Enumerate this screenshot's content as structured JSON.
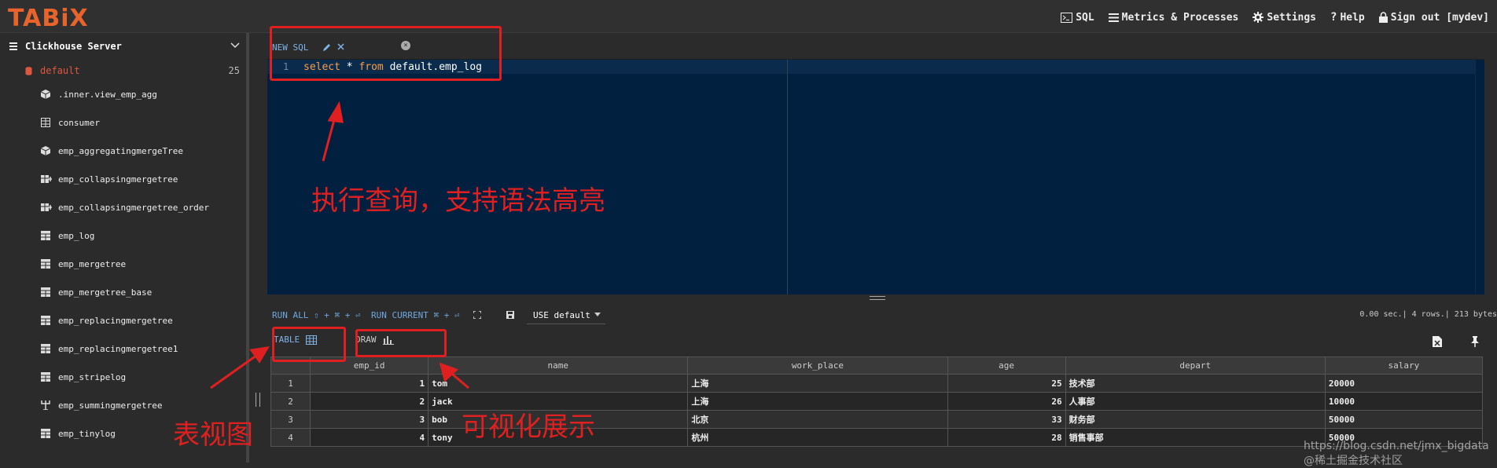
{
  "app": {
    "logo": "TABiX"
  },
  "topnav": [
    {
      "label": "SQL",
      "icon": "terminal-icon"
    },
    {
      "label": "Metrics & Processes",
      "icon": "list-icon"
    },
    {
      "label": "Settings",
      "icon": "gear-icon"
    },
    {
      "label": "Help",
      "icon": "question-icon"
    },
    {
      "label": "Sign out [mydev]",
      "icon": "lock-icon"
    }
  ],
  "sidebar": {
    "server": "Clickhouse Server",
    "database": {
      "name": "default",
      "count": "25"
    },
    "tables": [
      {
        "name": ".inner.view_emp_agg",
        "icon": "cube-icon"
      },
      {
        "name": "consumer",
        "icon": "grid-outline-icon"
      },
      {
        "name": "emp_aggregatingmergeTree",
        "icon": "cube-icon"
      },
      {
        "name": "emp_collapsingmergetree",
        "icon": "table-plus-icon"
      },
      {
        "name": "emp_collapsingmergetree_order",
        "icon": "table-plus-icon"
      },
      {
        "name": "emp_log",
        "icon": "table-icon"
      },
      {
        "name": "emp_mergetree",
        "icon": "table-icon"
      },
      {
        "name": "emp_mergetree_base",
        "icon": "table-icon"
      },
      {
        "name": "emp_replacingmergetree",
        "icon": "table-icon"
      },
      {
        "name": "emp_replacingmergetree1",
        "icon": "table-icon"
      },
      {
        "name": "emp_stripelog",
        "icon": "table-icon"
      },
      {
        "name": "emp_summingmergetree",
        "icon": "trident-icon"
      },
      {
        "name": "emp_tinylog",
        "icon": "table-icon"
      }
    ]
  },
  "editor": {
    "tab_label": "NEW SQL",
    "line_number": "1",
    "code_kw1": "select",
    "code_mid": " * ",
    "code_kw2": "from",
    "code_rest": " default.emp_log"
  },
  "toolbar": {
    "run_all": "RUN ALL ⇧ + ⌘ + ⏎",
    "run_current": "RUN CURRENT ⌘ + ⏎",
    "db_select": "USE default",
    "stats": "0.00 sec.| 4 rows.| 213 bytes"
  },
  "result_tabs": {
    "table": "TABLE",
    "draw": "DRAW"
  },
  "results": {
    "columns": [
      "emp_id",
      "name",
      "work_place",
      "age",
      "depart",
      "salary"
    ],
    "rows": [
      {
        "n": "1",
        "emp_id": "1",
        "name": "tom",
        "work_place": "上海",
        "age": "25",
        "depart": "技术部",
        "salary": "20000"
      },
      {
        "n": "2",
        "emp_id": "2",
        "name": "jack",
        "work_place": "上海",
        "age": "26",
        "depart": "人事部",
        "salary": "10000"
      },
      {
        "n": "3",
        "emp_id": "3",
        "name": "bob",
        "work_place": "北京",
        "age": "33",
        "depart": "财务部",
        "salary": "50000"
      },
      {
        "n": "4",
        "emp_id": "4",
        "name": "tony",
        "work_place": "杭州",
        "age": "28",
        "depart": "销售事部",
        "salary": "50000"
      }
    ]
  },
  "annotations": {
    "query": "执行查询，支持语法高亮",
    "table_view": "表视图",
    "visual": "可视化展示"
  },
  "watermark": "https://blog.csdn.net/jmx_bigdata @稀土掘金技术社区"
}
